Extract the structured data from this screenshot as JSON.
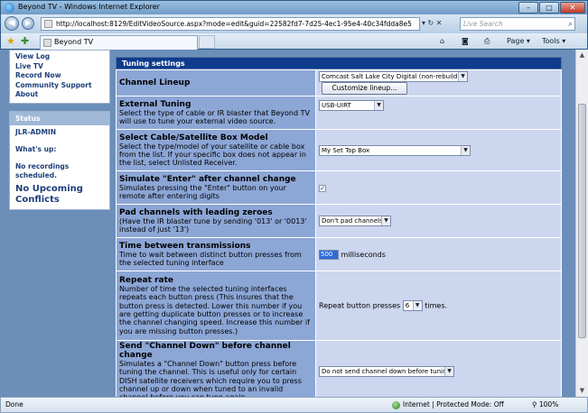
{
  "window": {
    "title": "Beyond TV - Windows Internet Explorer",
    "minimize_glyph": "–",
    "maximize_glyph": "□",
    "close_glyph": "✕"
  },
  "address": {
    "url": "http://localhost:8129/EditVideoSource.aspx?mode=edit&guid=22582fd7-7d25-4ec1-95e4-40c34fdda8e5",
    "tools_glyphs": "▾ ↻ ✕",
    "search_placeholder": "Live Search",
    "back_glyph": "◀",
    "forward_glyph": "▶"
  },
  "tabs": {
    "active_label": "Beyond TV",
    "command_page": "Page ▾",
    "command_tools": "Tools ▾"
  },
  "sidebar": {
    "nav_items": [
      "View Log",
      "Live TV",
      "Record Now",
      "Community Support",
      "About"
    ],
    "status": {
      "header": "Status",
      "user": "JLR-ADMIN",
      "whats_up_label": "What's up:",
      "recordings_text": "No recordings scheduled.",
      "conflicts_text": "No Upcoming Conflicts"
    }
  },
  "tuning": {
    "section_title": "Tuning settings",
    "channel_lineup": {
      "title": "Channel Lineup",
      "value": "Comcast Salt Lake City Digital (non-rebuild)",
      "button": "Customize lineup..."
    },
    "external_tuning": {
      "title": "External Tuning",
      "desc": "Select the type of cable or IR blaster that Beyond TV will use to tune your external video source.",
      "value": "USB-UIRT"
    },
    "box_model": {
      "title": "Select Cable/Satellite Box Model",
      "desc": "Select the type/model of your satellite or cable box from the list. If your specific box does not appear in the list, select Unlisted Receiver.",
      "value": "My Set Top Box"
    },
    "simulate_enter": {
      "title": "Simulate \"Enter\" after channel change",
      "desc": "Simulates pressing the \"Enter\" button on your remote after entering digits",
      "check_glyph": "✓"
    },
    "pad_zeroes": {
      "title": "Pad channels with leading zeroes",
      "desc": "(Have the IR blaster tune by sending '013' or '0013' instead of just '13')",
      "value": "Don't pad channels"
    },
    "time_between": {
      "title": "Time between transmissions",
      "desc": "Time to wait between distinct button presses from the selected tuning interface",
      "value": "500",
      "unit": "milliseconds"
    },
    "repeat_rate": {
      "title": "Repeat rate",
      "desc": "Number of time the selected tuning interfaces repeats each button press (This insures that the button press is detected. Lower this number if you are getting duplicate button presses or to increase the channel changing speed. Increase this number if you are missing button presses.)",
      "prefix": "Repeat button presses",
      "value": "6",
      "suffix": "times."
    },
    "channel_down": {
      "title": "Send \"Channel Down\" before channel change",
      "desc": "Simulates a \"Channel Down\" button press before tuning the channel. This is useful only for certain DISH satellite receivers which require you to press channel up or down when tuned to an invalid channel before you can tune again.",
      "value": "Do not send channel down before tuning"
    }
  },
  "statusbar": {
    "left": "Done",
    "zone": "Internet | Protected Mode: Off",
    "zoom": "100%"
  }
}
